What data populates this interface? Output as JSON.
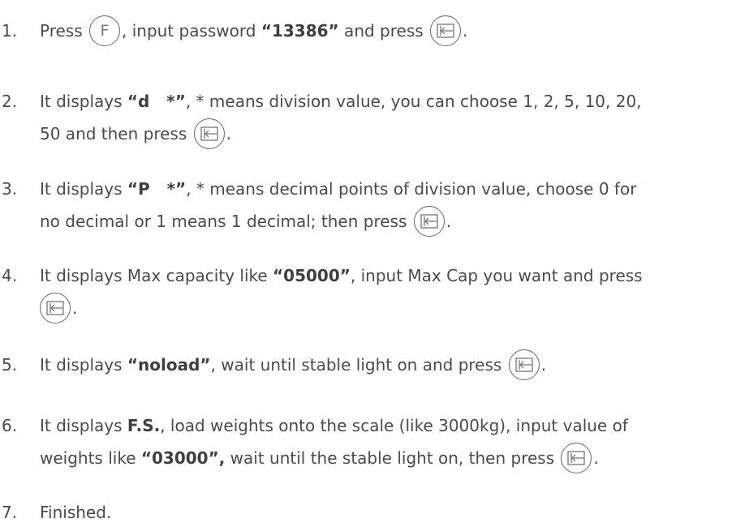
{
  "steps": [
    {
      "num": "1.",
      "a": "Press",
      "b": ", input password ",
      "bold1": "“13386”",
      "c": " and press",
      "d": "."
    },
    {
      "num": "2.",
      "a": "It displays ",
      "bold1": "“d   *”",
      "b": ", * means division value, you can choose 1, 2, 5, 10, 20,",
      "line2": "50 and then press",
      "c": "."
    },
    {
      "num": "3.",
      "a": "It displays ",
      "bold1": "“P   *”",
      "b": ", * means decimal points of division value, choose 0 for",
      "line2": "no decimal or 1 means 1 decimal; then press",
      "c": "."
    },
    {
      "num": "4.",
      "a": "It displays Max capacity like ",
      "bold1": "“05000”",
      "b": ", input Max Cap you want and press",
      "c": "."
    },
    {
      "num": "5.",
      "a": "It displays ",
      "bold1": "“noload”",
      "b": ", wait until stable light on and press",
      "c": "."
    },
    {
      "num": "6.",
      "a": "It displays ",
      "bold1": "F.S.",
      "b": ", load weights onto the scale (like 3000kg), input value of",
      "line2a": "weights like ",
      "bold2": "“03000”,",
      "line2b": " wait until the stable light on, then press",
      "c": "."
    },
    {
      "num": "7.",
      "a": "Finished."
    }
  ],
  "keys": {
    "f_key_label": "F",
    "enter_key_icon": "enter-icon"
  }
}
